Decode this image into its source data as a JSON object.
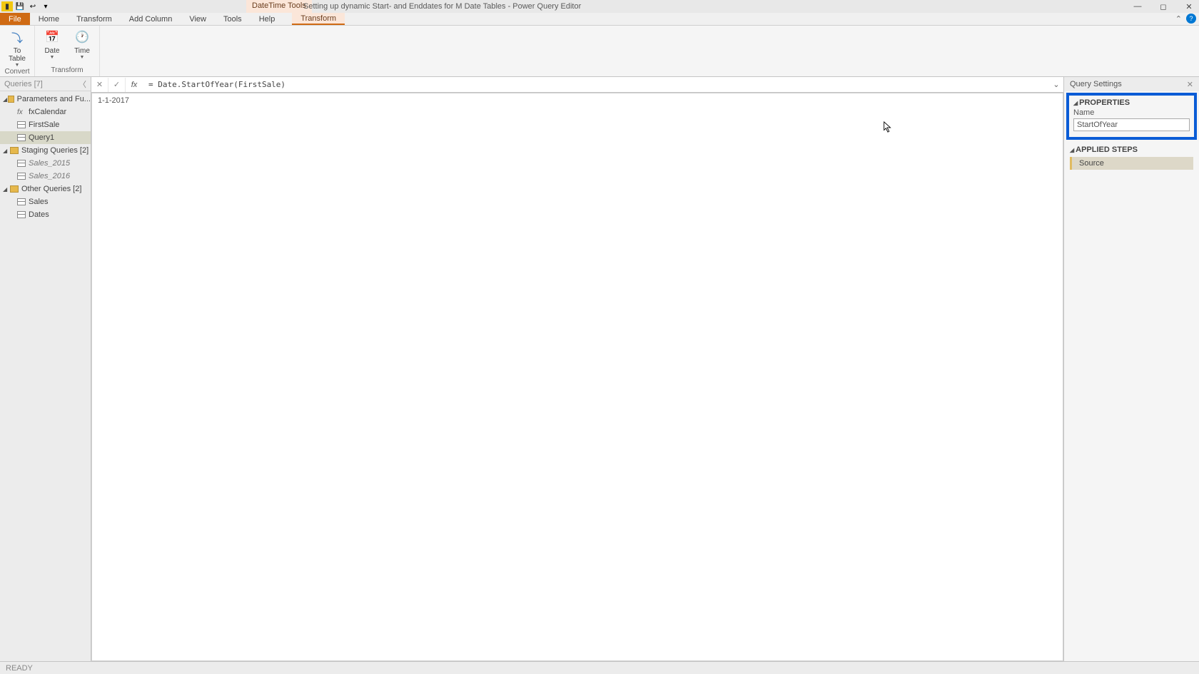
{
  "title": "Setting up dynamic Start- and Enddates for M Date Tables - Power Query Editor",
  "context_tab": "DateTime Tools",
  "tabs": {
    "file": "File",
    "home": "Home",
    "transform": "Transform",
    "add_column": "Add Column",
    "view": "View",
    "tools": "Tools",
    "help": "Help",
    "ctx_transform": "Transform"
  },
  "ribbon": {
    "to_table": "To\nTable",
    "date": "Date",
    "time": "Time",
    "group_convert": "Convert",
    "group_transform": "Transform"
  },
  "queries": {
    "header": "Queries [7]",
    "groups": [
      {
        "label": "Parameters and Fu...",
        "items": [
          {
            "kind": "fx",
            "label": "fxCalendar"
          },
          {
            "kind": "tbl",
            "label": "FirstSale"
          },
          {
            "kind": "tbl",
            "label": "Query1",
            "selected": true
          }
        ]
      },
      {
        "label": "Staging Queries [2]",
        "items": [
          {
            "kind": "tbl",
            "label": "Sales_2015",
            "italic": true
          },
          {
            "kind": "tbl",
            "label": "Sales_2016",
            "italic": true
          }
        ]
      },
      {
        "label": "Other Queries [2]",
        "items": [
          {
            "kind": "tbl",
            "label": "Sales"
          },
          {
            "kind": "tbl",
            "label": "Dates"
          }
        ]
      }
    ]
  },
  "formula": "= Date.StartOfYear(FirstSale)",
  "preview_value": "1-1-2017",
  "settings": {
    "title": "Query Settings",
    "properties_hdr": "PROPERTIES",
    "name_label": "Name",
    "name_value": "StartOfYear",
    "applied_hdr": "APPLIED STEPS",
    "steps": [
      "Source"
    ]
  },
  "status": "READY"
}
